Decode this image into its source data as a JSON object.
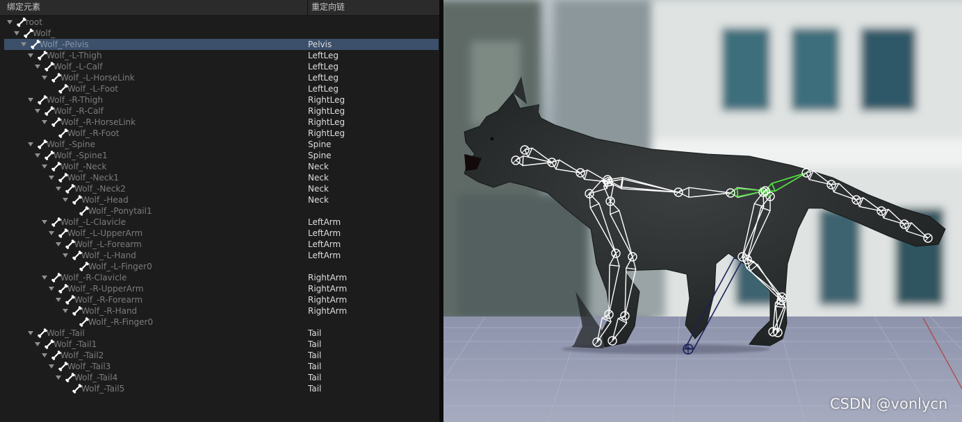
{
  "panel": {
    "columns": {
      "bone": "绑定元素",
      "chain": "重定向链"
    },
    "selected_index": 2,
    "rows": [
      {
        "name": "root",
        "depth": 0,
        "chain": "",
        "expander": true
      },
      {
        "name": "Wolf_",
        "depth": 1,
        "chain": "",
        "expander": true
      },
      {
        "name": "Wolf_-Pelvis",
        "depth": 2,
        "chain": "Pelvis",
        "expander": true
      },
      {
        "name": "Wolf_-L-Thigh",
        "depth": 3,
        "chain": "LeftLeg",
        "expander": true
      },
      {
        "name": "Wolf_-L-Calf",
        "depth": 4,
        "chain": "LeftLeg",
        "expander": true
      },
      {
        "name": "Wolf_-L-HorseLink",
        "depth": 5,
        "chain": "LeftLeg",
        "expander": true
      },
      {
        "name": "Wolf_-L-Foot",
        "depth": 6,
        "chain": "LeftLeg",
        "expander": false
      },
      {
        "name": "Wolf_-R-Thigh",
        "depth": 3,
        "chain": "RightLeg",
        "expander": true
      },
      {
        "name": "Wolf_-R-Calf",
        "depth": 4,
        "chain": "RightLeg",
        "expander": true
      },
      {
        "name": "Wolf_-R-HorseLink",
        "depth": 5,
        "chain": "RightLeg",
        "expander": true
      },
      {
        "name": "Wolf_-R-Foot",
        "depth": 6,
        "chain": "RightLeg",
        "expander": false
      },
      {
        "name": "Wolf_-Spine",
        "depth": 3,
        "chain": "Spine",
        "expander": true
      },
      {
        "name": "Wolf_-Spine1",
        "depth": 4,
        "chain": "Spine",
        "expander": true
      },
      {
        "name": "Wolf_-Neck",
        "depth": 5,
        "chain": "Neck",
        "expander": true
      },
      {
        "name": "Wolf_-Neck1",
        "depth": 6,
        "chain": "Neck",
        "expander": true
      },
      {
        "name": "Wolf_-Neck2",
        "depth": 7,
        "chain": "Neck",
        "expander": true
      },
      {
        "name": "Wolf_-Head",
        "depth": 8,
        "chain": "Neck",
        "expander": true
      },
      {
        "name": "Wolf_-Ponytail1",
        "depth": 9,
        "chain": "",
        "expander": false
      },
      {
        "name": "Wolf_-L-Clavicle",
        "depth": 5,
        "chain": "LeftArm",
        "expander": true
      },
      {
        "name": "Wolf_-L-UpperArm",
        "depth": 6,
        "chain": "LeftArm",
        "expander": true
      },
      {
        "name": "Wolf_-L-Forearm",
        "depth": 7,
        "chain": "LeftArm",
        "expander": true
      },
      {
        "name": "Wolf_-L-Hand",
        "depth": 8,
        "chain": "LeftArm",
        "expander": true
      },
      {
        "name": "Wolf_-L-Finger0",
        "depth": 9,
        "chain": "",
        "expander": false
      },
      {
        "name": "Wolf_-R-Clavicle",
        "depth": 5,
        "chain": "RightArm",
        "expander": true
      },
      {
        "name": "Wolf_-R-UpperArm",
        "depth": 6,
        "chain": "RightArm",
        "expander": true
      },
      {
        "name": "Wolf_-R-Forearm",
        "depth": 7,
        "chain": "RightArm",
        "expander": true
      },
      {
        "name": "Wolf_-R-Hand",
        "depth": 8,
        "chain": "RightArm",
        "expander": true
      },
      {
        "name": "Wolf_-R-Finger0",
        "depth": 9,
        "chain": "",
        "expander": false
      },
      {
        "name": "Wolf_-Tail",
        "depth": 3,
        "chain": "Tail",
        "expander": true
      },
      {
        "name": "Wolf_-Tail1",
        "depth": 4,
        "chain": "Tail",
        "expander": true
      },
      {
        "name": "Wolf_-Tail2",
        "depth": 5,
        "chain": "Tail",
        "expander": true
      },
      {
        "name": "Wolf_-Tail3",
        "depth": 6,
        "chain": "Tail",
        "expander": true
      },
      {
        "name": "Wolf_-Tail4",
        "depth": 7,
        "chain": "Tail",
        "expander": true
      },
      {
        "name": "Wolf_-Tail5",
        "depth": 8,
        "chain": "Tail",
        "expander": false
      }
    ]
  },
  "viewport": {
    "watermark": "CSDN @vonlycn",
    "colors": {
      "bone": "#ffffff",
      "selected_bone": "#55dd44",
      "ik_bone": "#2a2f5e",
      "ground": "#9aa0b8"
    }
  },
  "icons": {
    "bone": "bone-icon",
    "expander": "expand-arrow-icon"
  }
}
